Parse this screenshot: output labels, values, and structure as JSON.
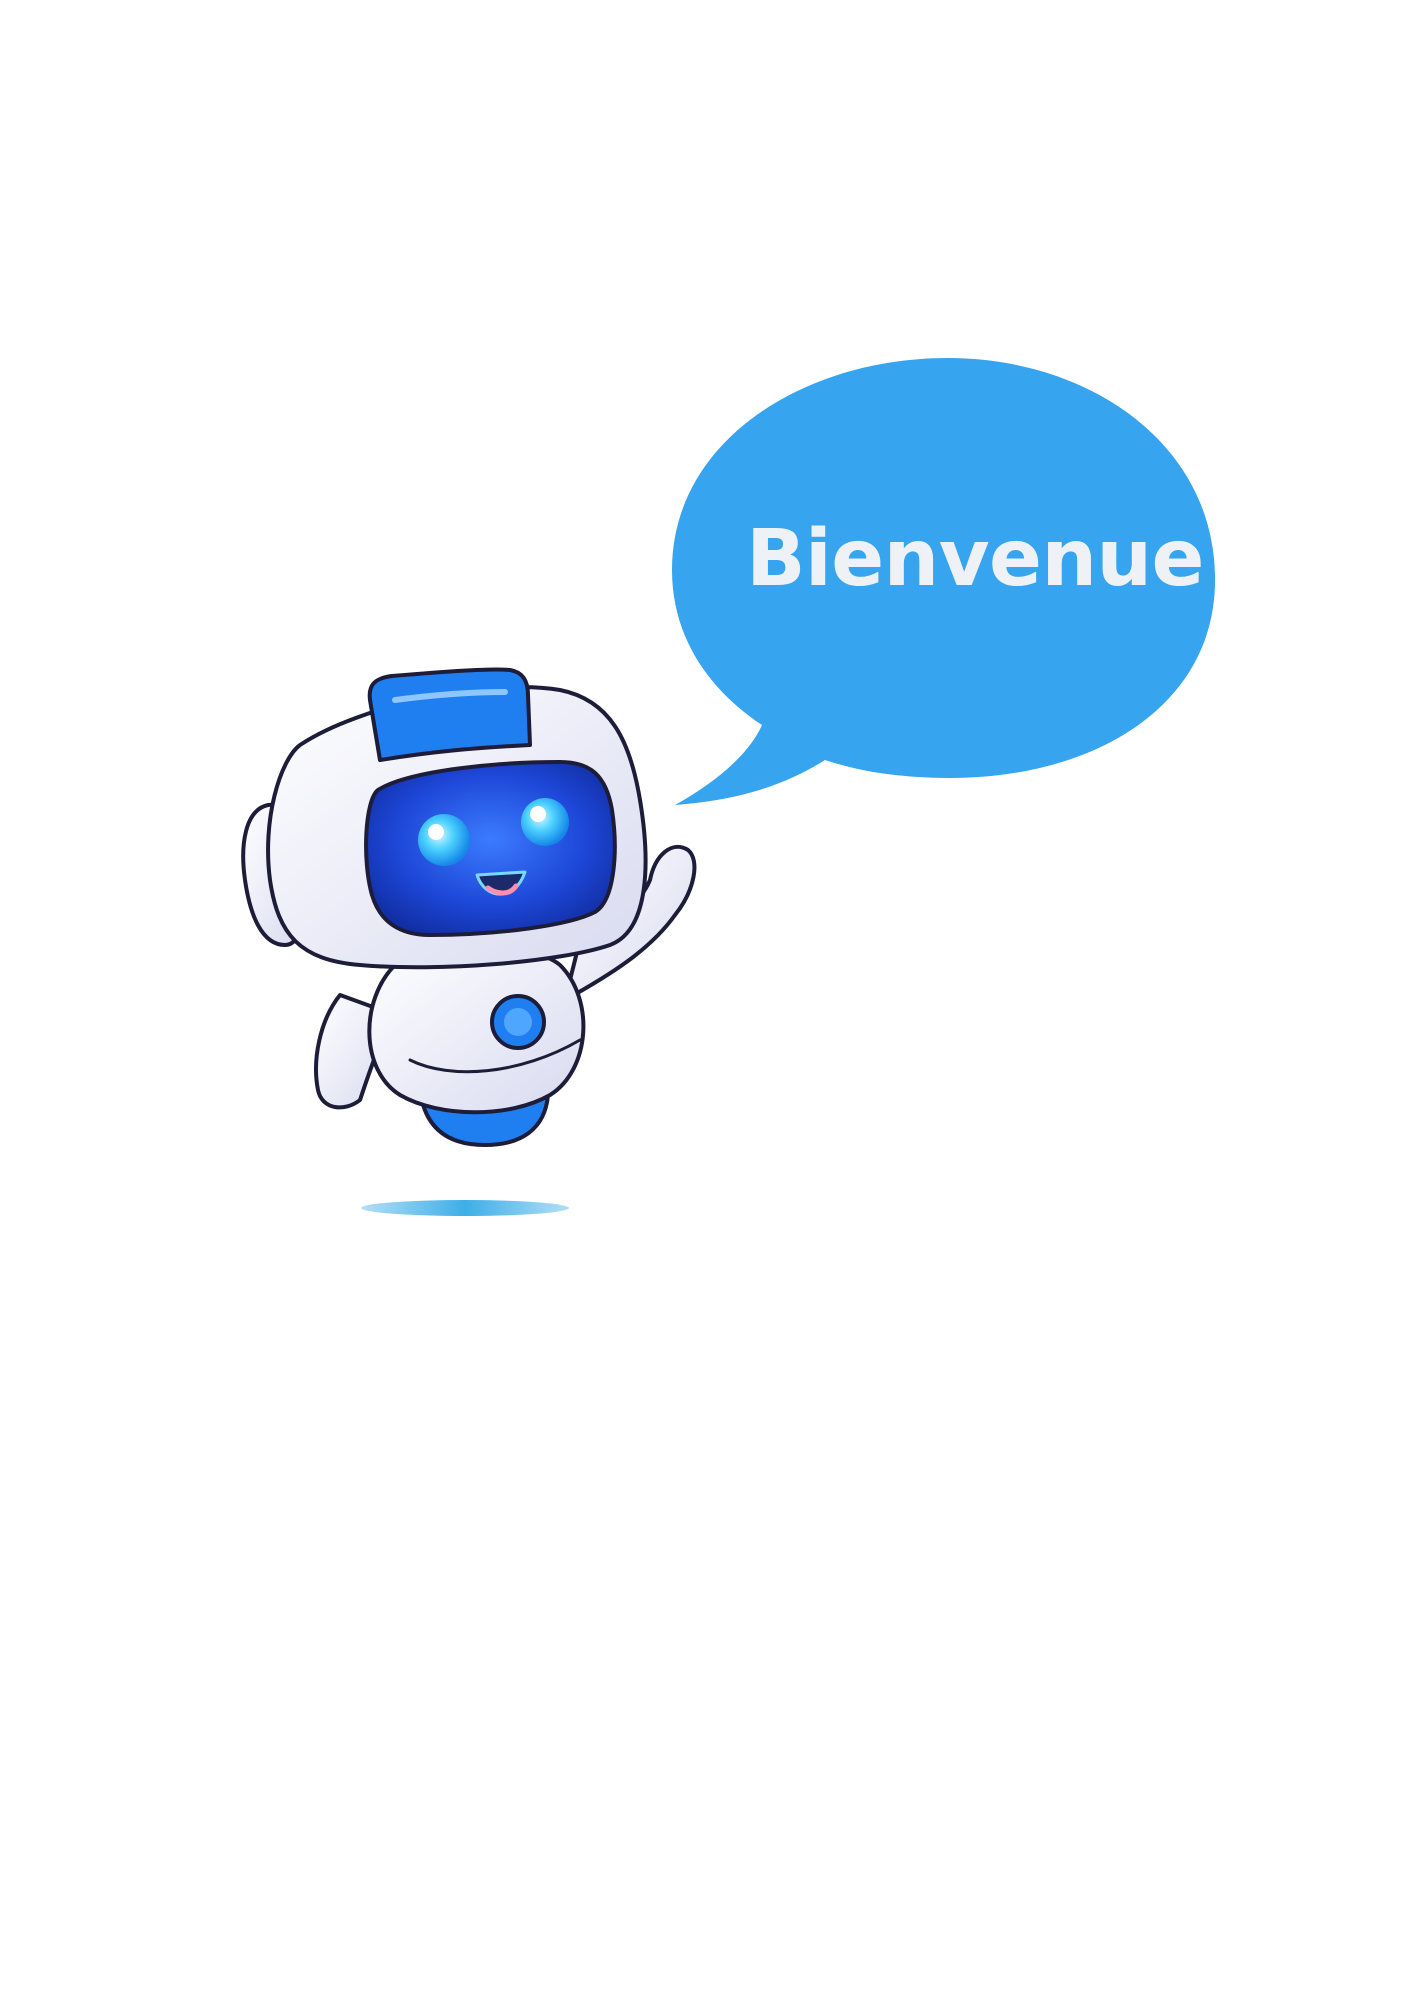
{
  "speech_bubble": {
    "text": "Bienvenue"
  },
  "mascot": {
    "icon": "robot-mascot-icon"
  },
  "colors": {
    "bubble": "#36a4ee",
    "bubble_text": "#eef1f5",
    "robot_accent": "#1f7ff0",
    "robot_screen": "#1c3fd0",
    "robot_body": "#f2f3fa",
    "robot_outline": "#1d1d3a",
    "shadow": "#3eaee8"
  }
}
